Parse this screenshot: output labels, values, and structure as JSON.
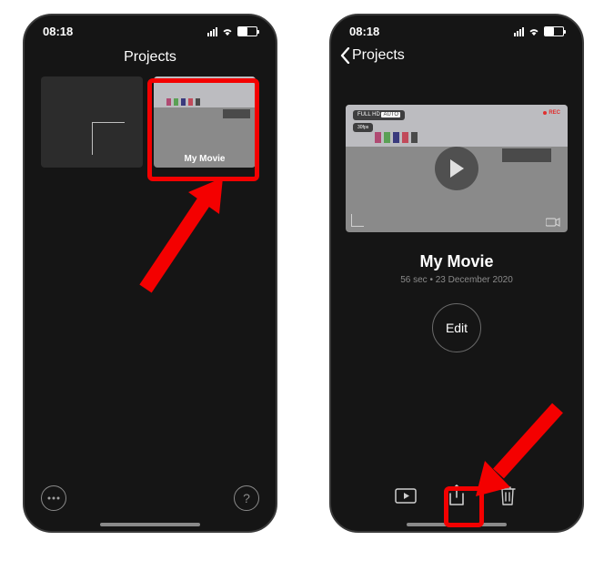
{
  "status": {
    "time": "08:18"
  },
  "left": {
    "title": "Projects",
    "movie_label": "My Movie"
  },
  "right": {
    "back_label": "Projects",
    "hud_quality": "FULL HD",
    "hud_auto": "AUTO",
    "hud_fps": "30fps",
    "hud_rec": "REC",
    "title": "My Movie",
    "meta": "56 sec • 23 December 2020",
    "edit_label": "Edit"
  }
}
